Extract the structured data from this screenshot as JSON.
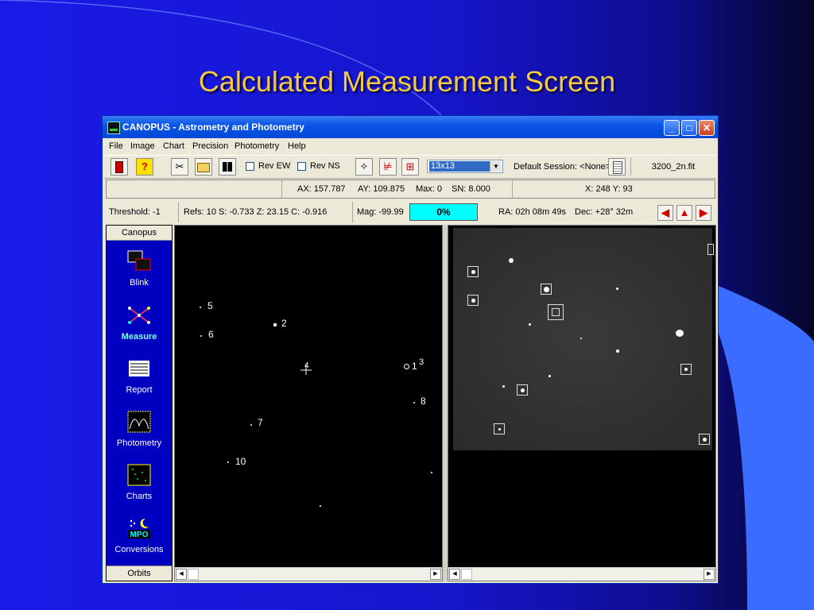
{
  "slide": {
    "title": "Calculated Measurement Screen",
    "colors": {
      "title": "#f5c84a",
      "background": "#1818d8"
    }
  },
  "window": {
    "title": "CANOPUS - Astrometry and Photometry",
    "controls": [
      "minimize",
      "maximize",
      "close"
    ]
  },
  "menu": [
    "File",
    "Image",
    "Chart",
    "Precision",
    "Photometry",
    "Help"
  ],
  "toolbar": {
    "icons": [
      "exit-icon",
      "help-icon",
      "tools-icon",
      "open-folder-icon",
      "grid-icon",
      "crosshair-icon",
      "chart-icon",
      "chart-alt-icon"
    ],
    "help_glyph": "?",
    "rev_ew_label": "Rev EW",
    "rev_ns_label": "Rev NS",
    "aperture_value": "13x13",
    "session_label": "Default Session: <None>",
    "filename": "3200_2n.fit"
  },
  "info": {
    "ax": "AX:  157.787",
    "ay": "AY:  109.875",
    "max": "Max: 0",
    "sn": "SN:   8.000",
    "xy": "X: 248   Y: 93"
  },
  "status": {
    "threshold": "Threshold: -1",
    "refs": "Refs: 10  S: -0.733  Z: 23.15  C: -0.916",
    "mag": "Mag: -99.99",
    "progress": "0%",
    "ra": "RA: 02h 08m 49s",
    "dec": "Dec: +28° 32m"
  },
  "sidebar": {
    "header": "Canopus",
    "footer": "Orbits",
    "items": [
      {
        "label": "Blink",
        "icon": "blink-icon",
        "active": false
      },
      {
        "label": "Measure",
        "icon": "measure-icon",
        "active": true
      },
      {
        "label": "Report",
        "icon": "report-icon",
        "active": false
      },
      {
        "label": "Photometry",
        "icon": "photometry-icon",
        "active": false
      },
      {
        "label": "Charts",
        "icon": "charts-icon",
        "active": false
      },
      {
        "label": "Conversions",
        "icon": "conversions-icon",
        "active": false
      }
    ],
    "mpo_text": "MPO"
  },
  "chart_pane": {
    "labels": {
      "s5": "5",
      "s2": "2",
      "s6": "6",
      "s4": "4",
      "s1": "1",
      "s3": "3",
      "s8": "8",
      "s7": "7",
      "s10": "10"
    }
  }
}
